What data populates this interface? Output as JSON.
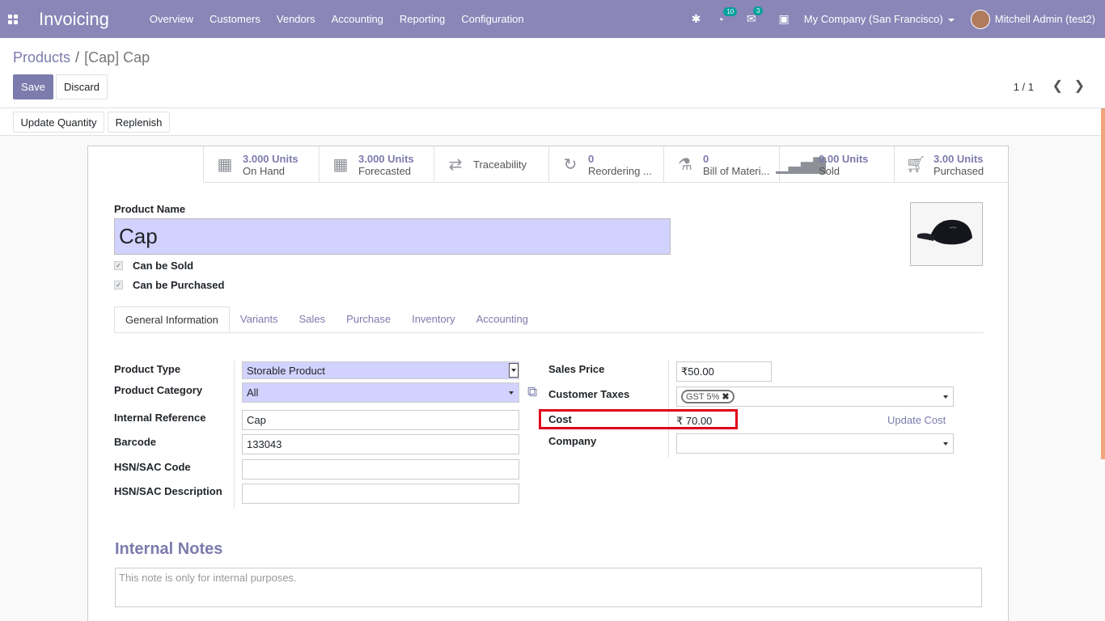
{
  "app_title": "Invoicing",
  "menu": [
    "Overview",
    "Customers",
    "Vendors",
    "Accounting",
    "Reporting",
    "Configuration"
  ],
  "nav": {
    "activity_count": "10",
    "messages_count": "3",
    "company": "My Company (San Francisco)",
    "user": "Mitchell Admin (test2)"
  },
  "breadcrumb": {
    "parent": "Products",
    "sep": "/",
    "current": "[Cap] Cap"
  },
  "buttons": {
    "save": "Save",
    "discard": "Discard",
    "update_quantity": "Update Quantity",
    "replenish": "Replenish",
    "update_cost": "Update Cost"
  },
  "pager": "1 / 1",
  "smart_buttons": [
    {
      "value": "3.000 Units",
      "label": "On Hand",
      "icon": "cubes-icon"
    },
    {
      "value": "3.000 Units",
      "label": "Forecasted",
      "icon": "cubes-icon"
    },
    {
      "value": "",
      "label": "Traceability",
      "icon": "exchange-icon"
    },
    {
      "value": "0",
      "label": "Reordering ...",
      "icon": "refresh-icon"
    },
    {
      "value": "0",
      "label": "Bill of Materi...",
      "icon": "flask-icon"
    },
    {
      "value": "0.00 Units",
      "label": "Sold",
      "icon": "signal-icon"
    },
    {
      "value": "3.00 Units",
      "label": "Purchased",
      "icon": "cart-icon"
    }
  ],
  "product": {
    "name_label": "Product Name",
    "name": "Cap",
    "can_be_sold": "Can be Sold",
    "can_be_purchased": "Can be Purchased"
  },
  "tabs": [
    "General Information",
    "Variants",
    "Sales",
    "Purchase",
    "Inventory",
    "Accounting"
  ],
  "left_fields": {
    "product_type_label": "Product Type",
    "product_type": "Storable Product",
    "product_category_label": "Product Category",
    "product_category": "All",
    "internal_reference_label": "Internal Reference",
    "internal_reference": "Cap",
    "barcode_label": "Barcode",
    "barcode": "133043",
    "hsn_code_label": "HSN/SAC Code",
    "hsn_code": "",
    "hsn_desc_label": "HSN/SAC Description",
    "hsn_desc": ""
  },
  "right_fields": {
    "sales_price_label": "Sales Price",
    "sales_price": "₹50.00",
    "customer_taxes_label": "Customer Taxes",
    "tax_tag": "GST 5%",
    "cost_label": "Cost",
    "cost": "₹ 70.00",
    "company_label": "Company",
    "company": ""
  },
  "notes": {
    "title": "Internal Notes",
    "placeholder": "This note is only for internal purposes."
  },
  "colors": {
    "navbar": "#8a86b8",
    "primary": "#7c7bad",
    "required": "#d2d2ff",
    "highlight": "#e0001b"
  }
}
